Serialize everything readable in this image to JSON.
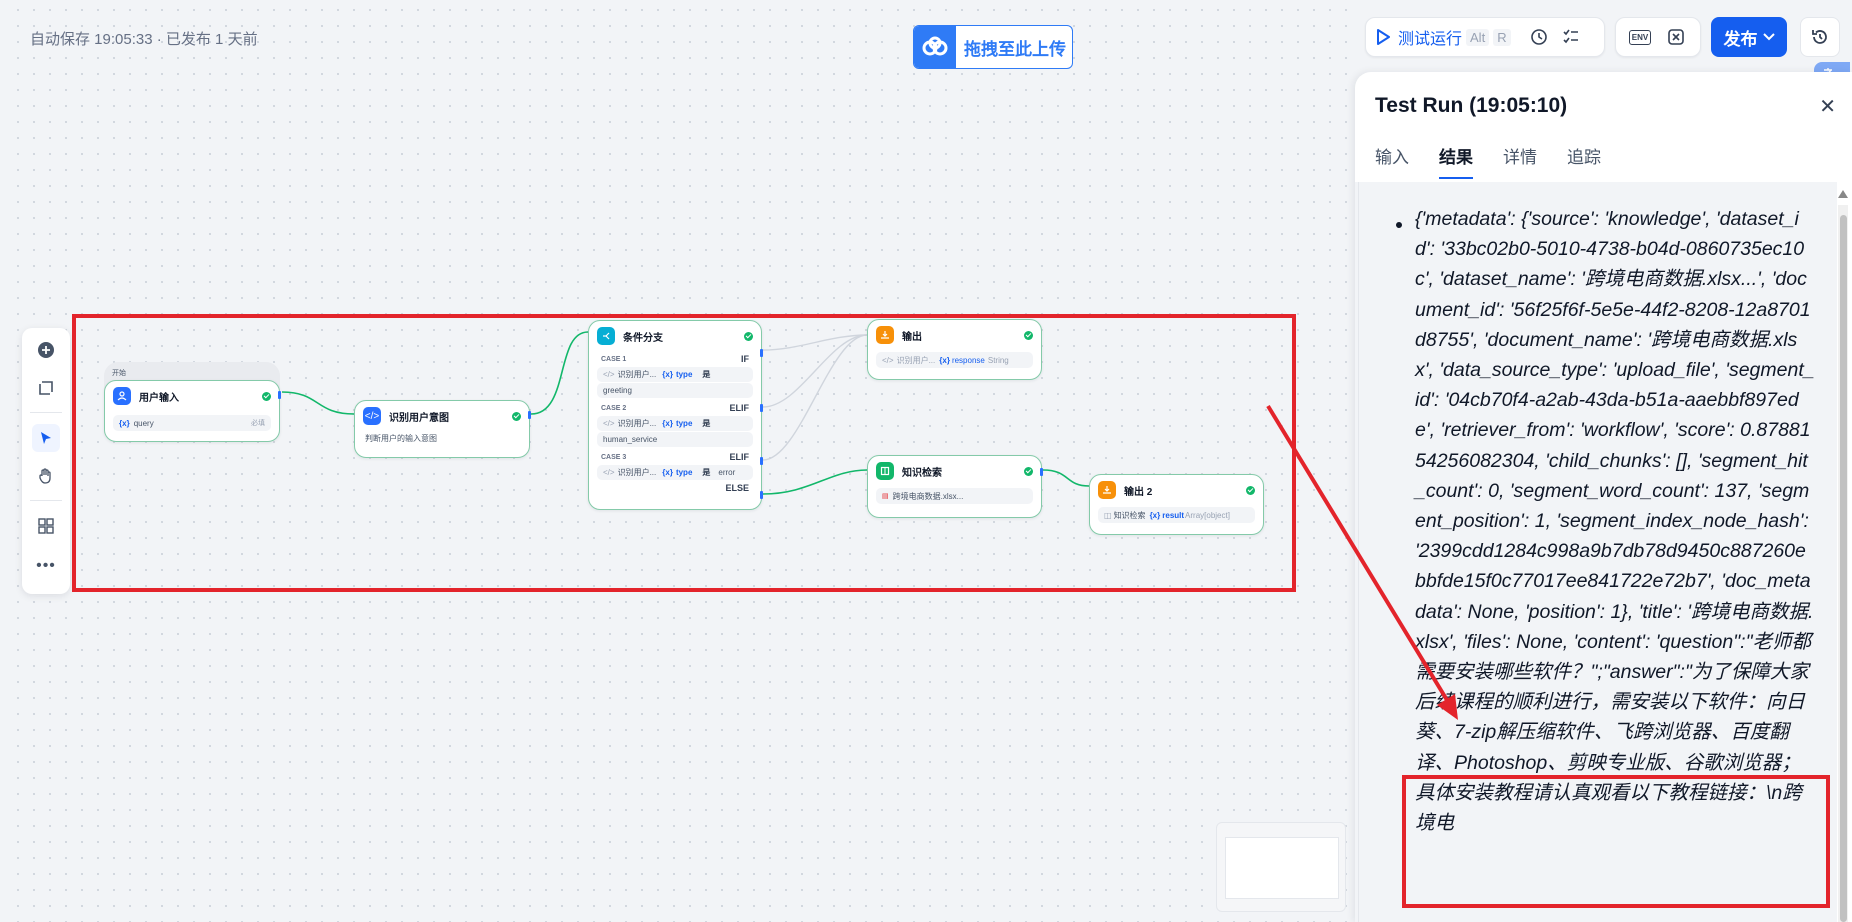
{
  "header": {
    "save_status": "自动保存 19:05:33 · 已发布 1 天前",
    "upload_label": "拖拽至此上传",
    "test_run_label": "测试运行",
    "shortcut_alt": "Alt",
    "shortcut_r": "R",
    "env_label": "ENV",
    "publish_label": "发布"
  },
  "nodes": {
    "start": {
      "group_label": "开始",
      "title": "用户输入",
      "var_name": "query",
      "required": "必填"
    },
    "intent": {
      "title": "识别用户意图",
      "desc": "判断用户的输入意图"
    },
    "branch": {
      "title": "条件分支",
      "case1": "CASE 1",
      "kw_if": "IF",
      "case2": "CASE 2",
      "kw_elif": "ELIF",
      "case3": "CASE 3",
      "kw_else": "ELSE",
      "ref": "识别用户...",
      "var": "type",
      "op": "是",
      "val1": "greeting",
      "val2": "human_service",
      "val3": "error"
    },
    "output1": {
      "title": "输出",
      "ref": "识别用户...",
      "var": "response",
      "type": "String"
    },
    "knowledge": {
      "title": "知识检索",
      "file": "跨境电商数据.xlsx..."
    },
    "output2": {
      "title": "输出 2",
      "ref": "知识检索",
      "var": "result",
      "type": "Array[object]"
    }
  },
  "panel": {
    "title": "Test Run (19:05:10)",
    "tabs": [
      "输入",
      "结果",
      "详情",
      "追踪"
    ],
    "active_tab": "结果",
    "result_text": "{'metadata': {'source': 'knowledge', 'dataset_id': '33bc02b0-5010-4738-b04d-0860735ec10c', 'dataset_name': '跨境电商数据.xlsx...', 'document_id': '56f25f6f-5e5e-44f2-8208-12a8701d8755', 'document_name': '跨境电商数据.xlsx', 'data_source_type': 'upload_file', 'segment_id': '04cb70f4-a2ab-43da-b51a-aaebbf897ede', 'retriever_from': 'workflow', 'score': 0.8788154256082304, 'child_chunks': [], 'segment_hit_count': 0, 'segment_word_count': 137, 'segment_position': 1, 'segment_index_node_hash': '2399cdd1284c998a9b7db78d9450c887260ebbfde15f0c77017ee841722e72b7', 'doc_metadata': None, 'position': 1}, 'title': '跨境电商数据.xlsx', 'files': None, 'content': 'question\":\"老师都需要安装哪些软件？\";\"answer\":\"为了保障大家后续课程的顺利进行，需安装以下软件：向日葵、7-zip解压缩软件、飞跨浏览器、百度翻译、Photoshop、剪映专业版、谷歌浏览器；具体安装教程请认真观看以下教程链接：\\n跨境电"
  },
  "colors": {
    "accent": "#155eef",
    "annotation": "#e3242b",
    "node_border": "#84caa9",
    "success": "#12b76a"
  }
}
